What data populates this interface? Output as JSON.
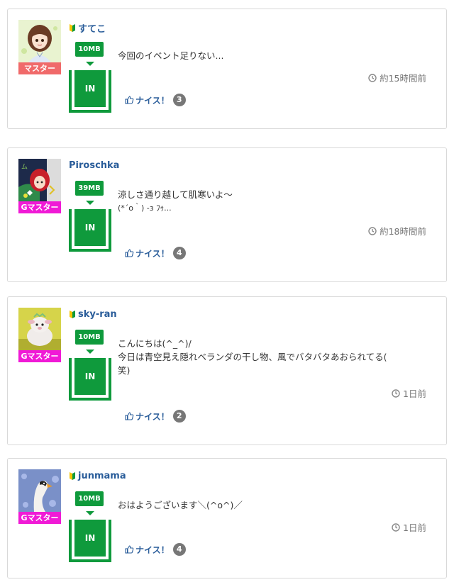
{
  "posts": [
    {
      "username": "すてこ",
      "beginner": true,
      "rank": "マスター",
      "size": "10MB",
      "in_label": "IN",
      "message_lines": [
        "今回のイベント足りない..."
      ],
      "time": "約15時間前",
      "nice_label": "ナイス！",
      "nice_count": "3",
      "avatar": "anime-girl"
    },
    {
      "username": "Piroschka",
      "beginner": false,
      "rank": "Gマスター",
      "size": "39MB",
      "in_label": "IN",
      "message_lines": [
        "涼しさ通り越して肌寒いよ〜",
        "(*´o｀) -з ﾌｩ..."
      ],
      "time": "約18時間前",
      "nice_label": "ナイス！",
      "nice_count": "4",
      "avatar": "red-hood"
    },
    {
      "username": "sky-ran",
      "beginner": true,
      "rank": "Gマスター",
      "size": "10MB",
      "in_label": "IN",
      "message_lines": [
        "こんにちは(^_^)/",
        "今日は青空見え隠れベランダの干し物、風でバタバタあおられてる(",
        "笑)"
      ],
      "time": "1日前",
      "nice_label": "ナイス！",
      "nice_count": "2",
      "avatar": "plush-sheep"
    },
    {
      "username": "junmama",
      "beginner": true,
      "rank": "Gマスター",
      "size": "10MB",
      "in_label": "IN",
      "message_lines": [
        "おはようございます＼(^o^)／"
      ],
      "time": "1日前",
      "nice_label": "ナイス！",
      "nice_count": "4",
      "avatar": "swan"
    }
  ],
  "colors": {
    "green": "#0f9a3c",
    "link": "#2a5d9a",
    "master": "#f06a6a",
    "gmaster": "#f01ad6"
  },
  "icons": {
    "beginner": "beginner-leaf-icon",
    "clock": "clock-icon",
    "nice": "thumbs-up-icon"
  }
}
